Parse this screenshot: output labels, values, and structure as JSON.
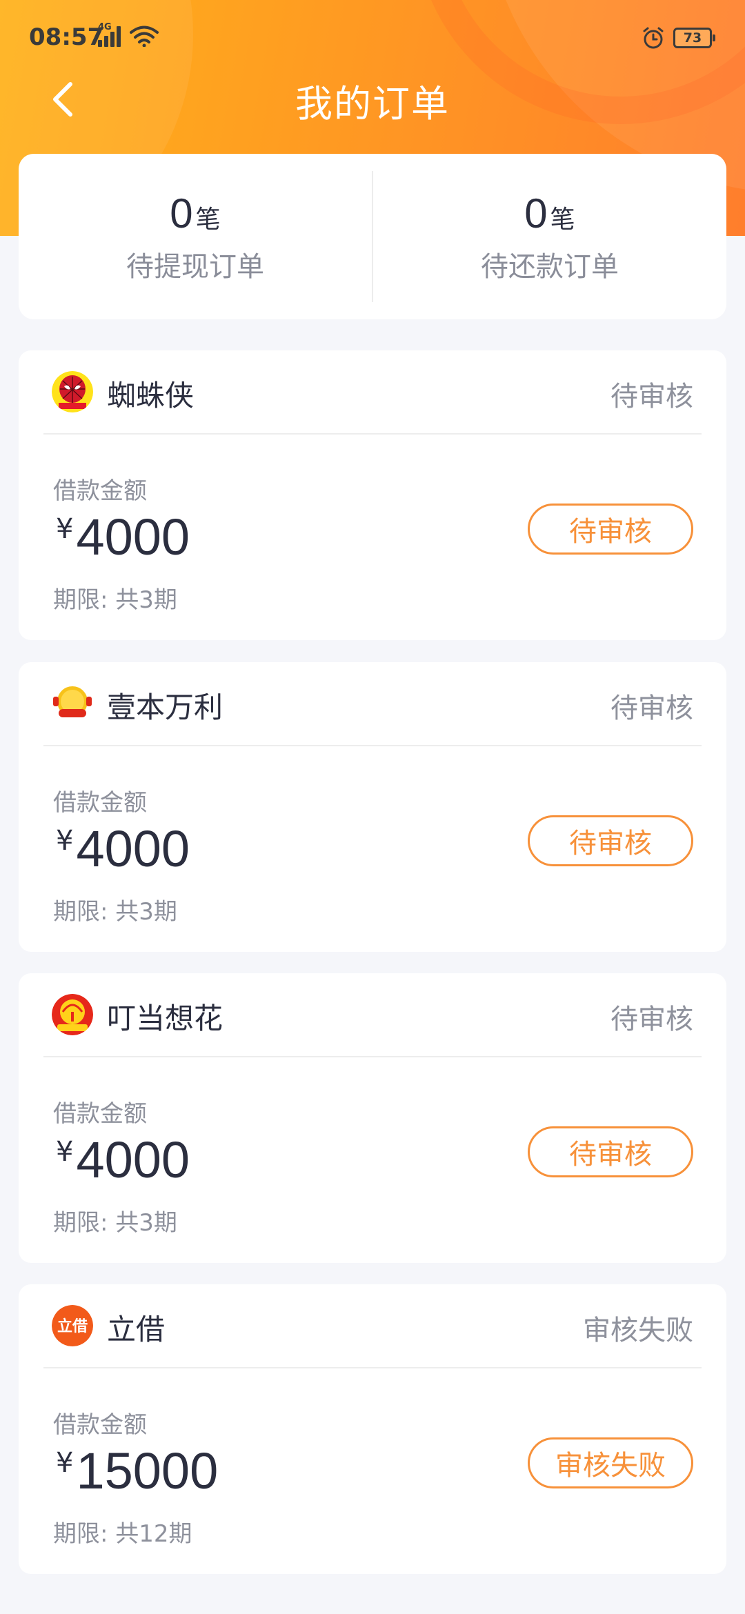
{
  "status_bar": {
    "time": "08:57",
    "network": "4G",
    "battery": "73"
  },
  "nav": {
    "title": "我的订单"
  },
  "summary": {
    "unit": "笔",
    "pending_withdraw": {
      "count": "0",
      "label": "待提现订单"
    },
    "pending_repay": {
      "count": "0",
      "label": "待还款订单"
    }
  },
  "orders": [
    {
      "app_name": "蜘蛛侠",
      "status": "待审核",
      "amount_label": "借款金额",
      "currency": "¥",
      "amount": "4000",
      "term": "期限: 共3期",
      "action_label": "待审核",
      "logo_text": "蜘蛛侠"
    },
    {
      "app_name": "壹本万利",
      "status": "待审核",
      "amount_label": "借款金额",
      "currency": "¥",
      "amount": "4000",
      "term": "期限: 共3期",
      "action_label": "待审核",
      "logo_text": "壹本万利"
    },
    {
      "app_name": "叮当想花",
      "status": "待审核",
      "amount_label": "借款金额",
      "currency": "¥",
      "amount": "4000",
      "term": "期限: 共3期",
      "action_label": "待审核",
      "logo_text": "叮当想花"
    },
    {
      "app_name": "立借",
      "status": "审核失败",
      "amount_label": "借款金额",
      "currency": "¥",
      "amount": "15000",
      "term": "期限: 共12期",
      "action_label": "审核失败",
      "logo_text": "立借"
    }
  ],
  "colors": {
    "accent": "#f7913a",
    "header_start": "#ffb21a",
    "header_end": "#ff7e2c",
    "text_primary": "#2b2e3f",
    "text_secondary": "#8e919c"
  },
  "icons": {
    "back": "chevron-left-icon",
    "signal": "signal-icon",
    "wifi": "wifi-icon",
    "alarm": "alarm-icon",
    "battery": "battery-icon"
  }
}
